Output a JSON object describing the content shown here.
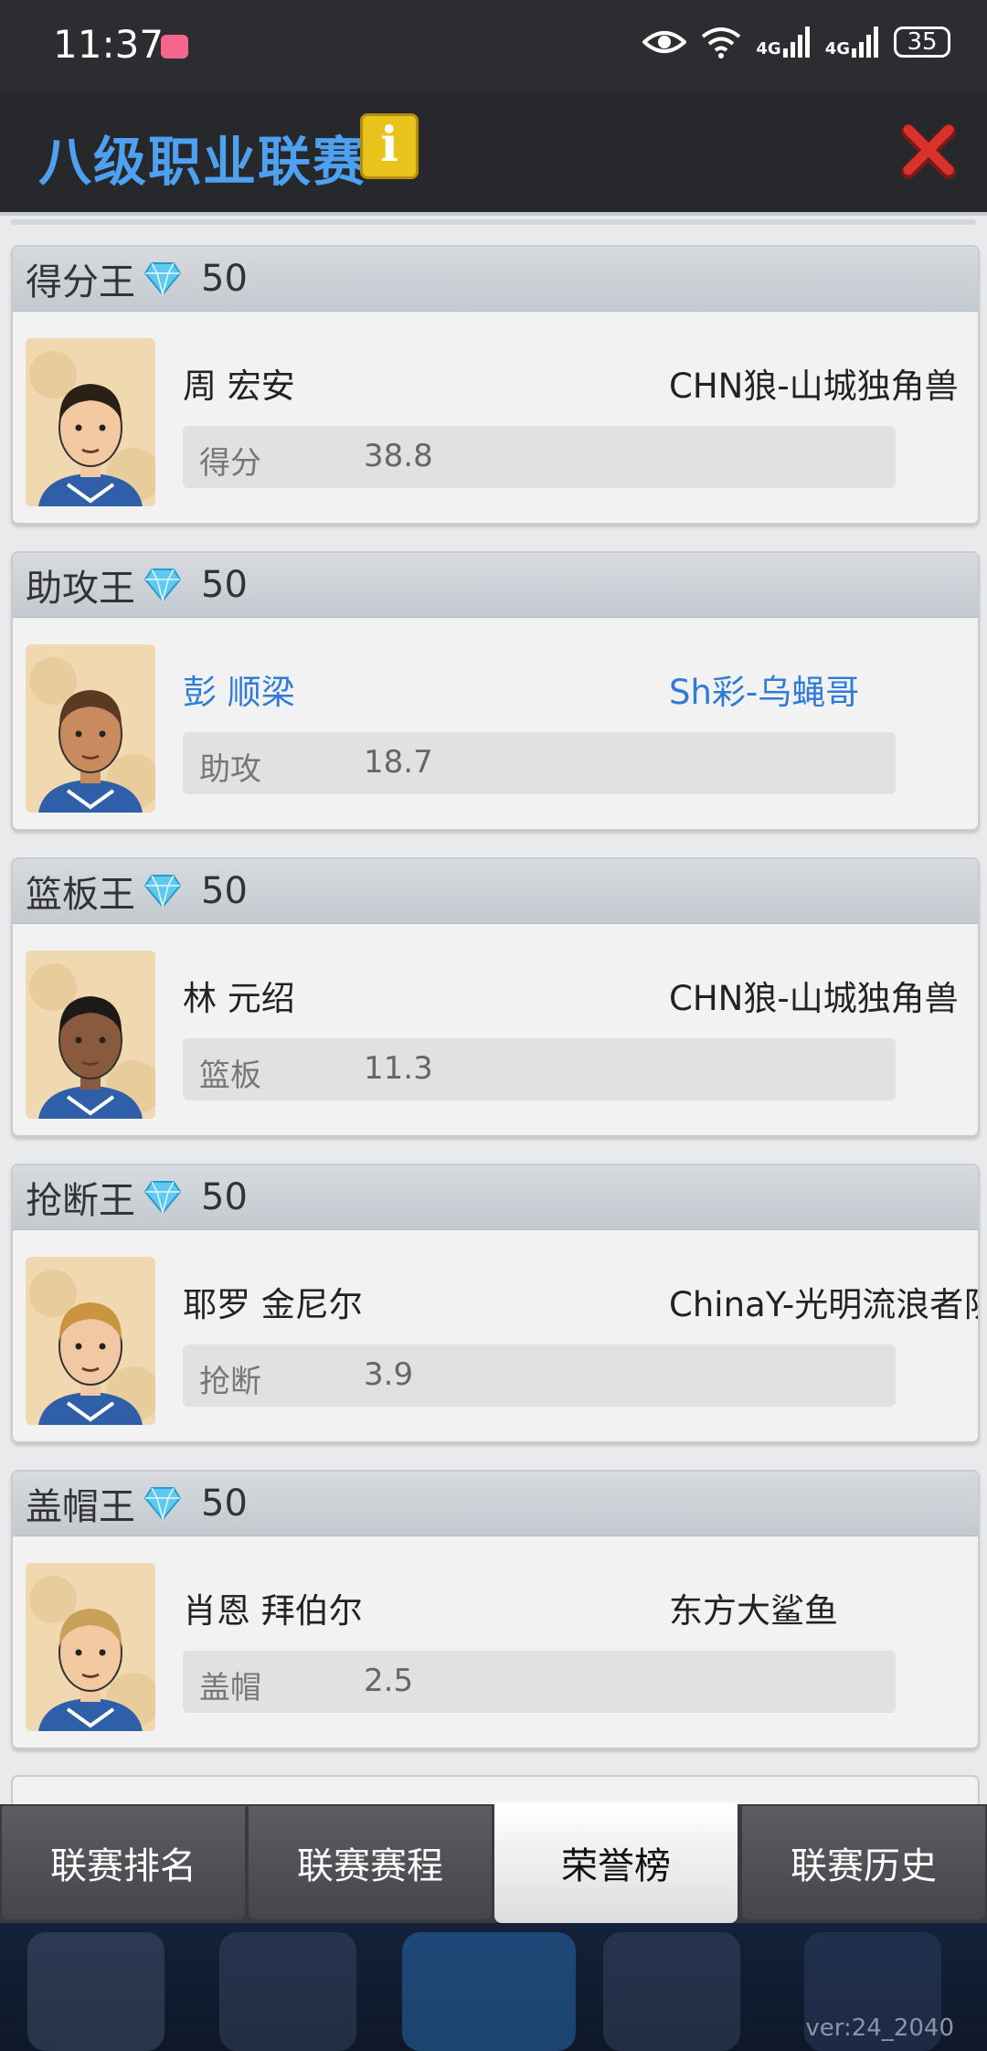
{
  "status_bar": {
    "time": "11:37",
    "battery": "35",
    "network1": "4G",
    "network2": "4G"
  },
  "header": {
    "title": "八级职业联赛",
    "info_label": "i"
  },
  "cards": [
    {
      "title": "得分王",
      "reward": "50",
      "player": "周 宏安",
      "team": "CHN狼-山城独角兽",
      "stat_label": "得分",
      "stat_value": "38.8",
      "highlight": false
    },
    {
      "title": "助攻王",
      "reward": "50",
      "player": "彭 顺梁",
      "team": "Sh彩-乌蝇哥",
      "stat_label": "助攻",
      "stat_value": "18.7",
      "highlight": true
    },
    {
      "title": "篮板王",
      "reward": "50",
      "player": "林 元绍",
      "team": "CHN狼-山城独角兽",
      "stat_label": "篮板",
      "stat_value": "11.3",
      "highlight": false
    },
    {
      "title": "抢断王",
      "reward": "50",
      "player": "耶罗 金尼尔",
      "team": "ChinaY-光明流浪者队",
      "stat_label": "抢断",
      "stat_value": "3.9",
      "highlight": false
    },
    {
      "title": "盖帽王",
      "reward": "50",
      "player": "肖恩 拜伯尔",
      "team": "东方大鲨鱼",
      "stat_label": "盖帽",
      "stat_value": "2.5",
      "highlight": false
    }
  ],
  "tabs": [
    "联赛排名",
    "联赛赛程",
    "荣誉榜",
    "联赛历史"
  ],
  "active_tab": "荣誉榜",
  "version": "ver:24_2040",
  "colors": {
    "title_blue": "#4ea1f0",
    "highlight_blue": "#2e7cd8",
    "close_red": "#d9322a",
    "info_yellow": "#e8c31c"
  }
}
